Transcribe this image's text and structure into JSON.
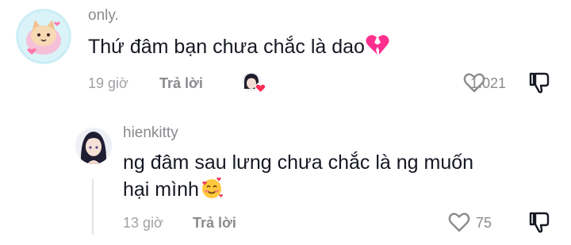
{
  "comments": [
    {
      "username": "only.",
      "text": "Thứ đâm bạn chưa chắc là dao",
      "emoji": "broken-heart",
      "time": "19 giờ",
      "reply_label": "Trả lời",
      "likes": "1.021",
      "liked_by_creator": true
    },
    {
      "username": "hienkitty",
      "text_line1": "ng đâm sau lưng chưa chắc là ng muốn",
      "text_line2": "hại mình",
      "emoji": "smiling-face-with-hearts",
      "time": "13 giờ",
      "reply_label": "Trả lời",
      "likes": "75"
    }
  ],
  "colors": {
    "text": "#161823",
    "muted": "#8a8a8f",
    "accent_heart": "#fe2c55",
    "broken_heart": "#ff3b8d"
  }
}
